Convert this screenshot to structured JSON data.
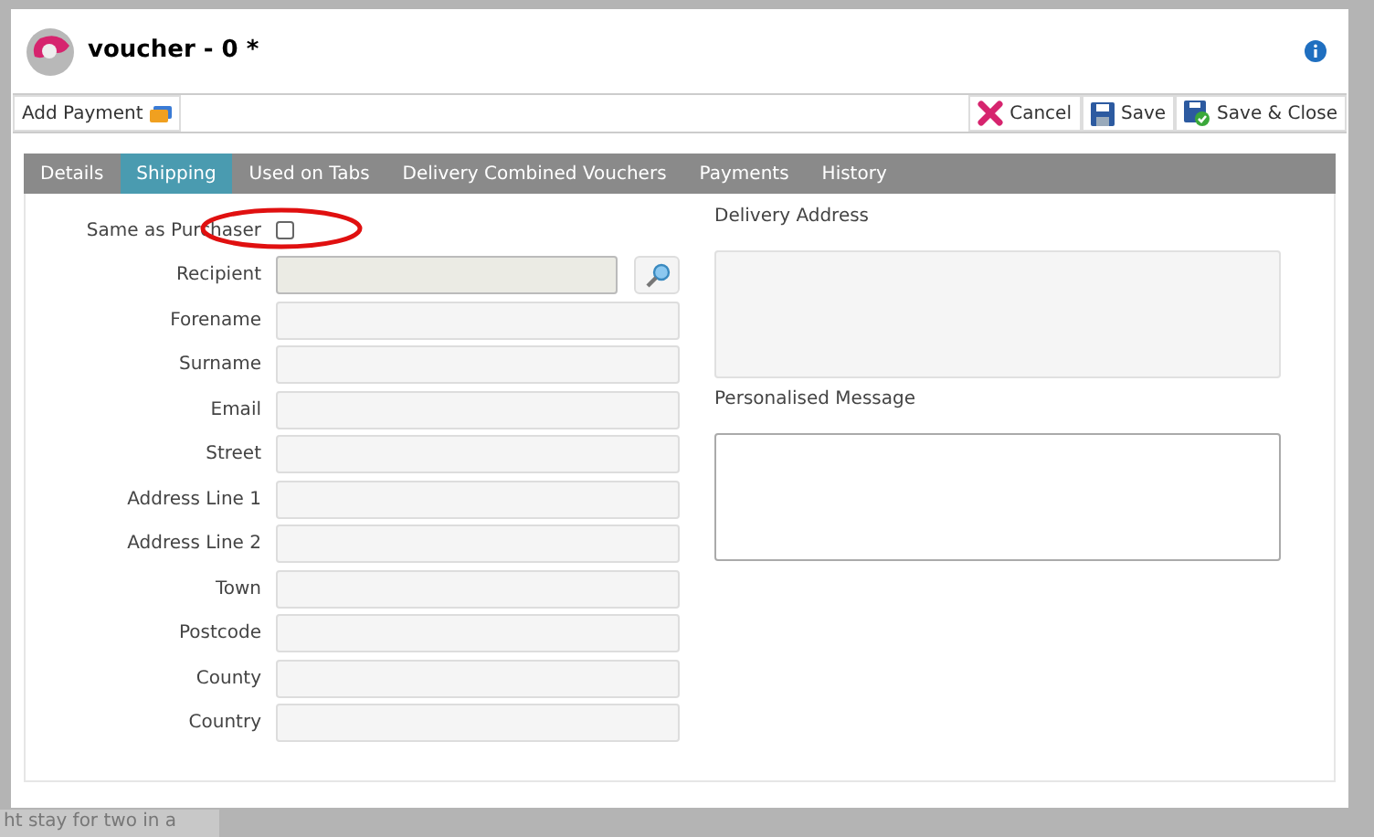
{
  "window": {
    "title": "voucher - 0 *"
  },
  "toolbar": {
    "left": [
      {
        "label": "Add Payment"
      }
    ],
    "right": [
      {
        "label": "Cancel"
      },
      {
        "label": "Save"
      },
      {
        "label": "Save & Close"
      }
    ]
  },
  "tabs": [
    {
      "label": "Details",
      "selected": false
    },
    {
      "label": "Shipping",
      "selected": true
    },
    {
      "label": "Used on Tabs",
      "selected": false
    },
    {
      "label": "Delivery Combined Vouchers",
      "selected": false
    },
    {
      "label": "Payments",
      "selected": false
    },
    {
      "label": "History",
      "selected": false
    }
  ],
  "form": [
    {
      "kind": "checkbox",
      "label": "Same as Purchaser",
      "checked": false,
      "highlighted": true
    },
    {
      "kind": "lookup",
      "label": "Recipient",
      "disabled": true
    },
    {
      "kind": "text",
      "label": "Forename"
    },
    {
      "kind": "text",
      "label": "Surname"
    },
    {
      "kind": "text",
      "label": "Email"
    },
    {
      "kind": "text",
      "label": "Street"
    },
    {
      "kind": "text",
      "label": "Address Line 1"
    },
    {
      "kind": "text",
      "label": "Address Line 2"
    },
    {
      "kind": "text",
      "label": "Town"
    },
    {
      "kind": "text",
      "label": "Postcode"
    },
    {
      "kind": "text",
      "label": "County"
    },
    {
      "kind": "text",
      "label": "Country"
    }
  ],
  "right_panel": [
    {
      "label": "Delivery Address",
      "disabled": true
    },
    {
      "label": "Personalised Message",
      "disabled": false
    }
  ],
  "background_text": "ht stay for two in a"
}
